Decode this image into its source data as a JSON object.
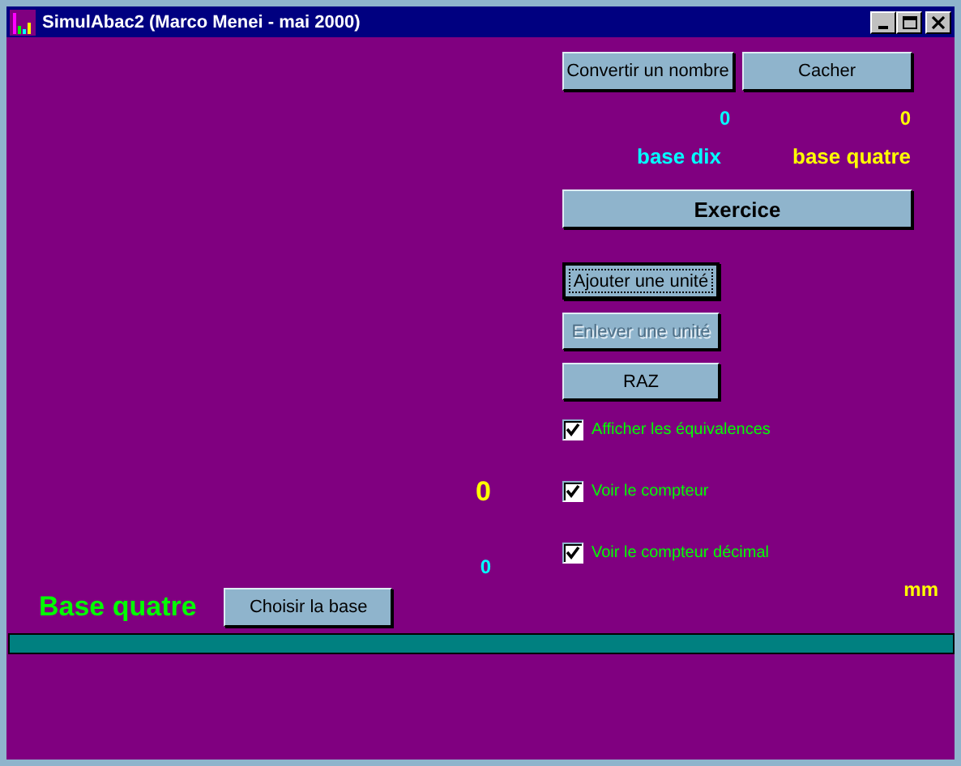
{
  "window": {
    "title": "SimulAbac2 (Marco Menei - mai 2000)"
  },
  "top_buttons": [
    {
      "label": "Convertir un nombre"
    },
    {
      "label": "Cacher"
    }
  ],
  "readouts": [
    {
      "value": "0",
      "label": "base dix",
      "color": "#00ffff"
    },
    {
      "value": "0",
      "label": "base quatre",
      "color": "#ffff00"
    }
  ],
  "exercise_button": {
    "label": "Exercice"
  },
  "action_buttons": [
    {
      "label": "Ajouter une unité",
      "focused": true,
      "disabled": false
    },
    {
      "label": "Enlever une unité",
      "focused": false,
      "disabled": true
    },
    {
      "label": "RAZ",
      "focused": false,
      "disabled": false
    }
  ],
  "options": [
    {
      "label": "Afficher les équivalences",
      "checked": true
    },
    {
      "label": "Voir le compteur",
      "checked": true
    },
    {
      "label": "Voir le compteur décimal",
      "checked": true
    }
  ],
  "counter": "0",
  "decimal_counter": "0",
  "base_name": "Base quatre",
  "choose_base_button": "Choisir la base",
  "unit": "mm"
}
